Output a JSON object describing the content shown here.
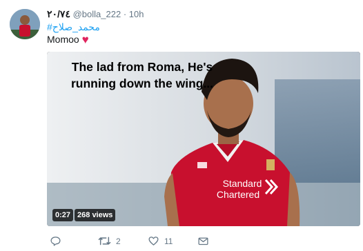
{
  "tweet": {
    "display_name": "٢٠/٧٤",
    "handle": "@bolla_222",
    "separator": "·",
    "time": "10h",
    "hashtag": "#محمد_صلاح",
    "text": "Momoo",
    "heart_glyph": "♥",
    "media": {
      "caption": "The lad from Roma, He's running down the wing...",
      "duration": "0:27",
      "views": "268 views",
      "sponsor_text": "Standard Chartered",
      "shirt_color": "#c8102e"
    },
    "actions": {
      "reply_icon": "reply-icon",
      "retweet_count": "2",
      "like_count": "11",
      "message_icon": "message-icon"
    }
  },
  "colors": {
    "link": "#1da1f2",
    "muted": "#657786",
    "heart": "#e0245e"
  }
}
